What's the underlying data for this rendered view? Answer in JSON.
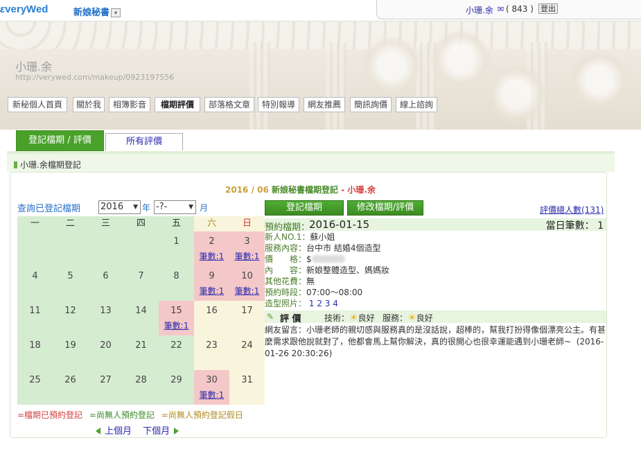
{
  "header": {
    "logo": "veryWed",
    "site_menu": "新娘秘書",
    "dropdown_icon": "▾",
    "user_name": "小珊.余",
    "mail_icon": "✉",
    "user_count": "( 843 )",
    "logout": "登出"
  },
  "profile": {
    "name": "小珊.余",
    "url": "http://verywed.com/makeup/0923197556"
  },
  "nav": [
    {
      "label": "新秘個人首頁"
    },
    {
      "label": "關於我"
    },
    {
      "label": "相簿影音"
    },
    {
      "label": "檔期評價",
      "active": true
    },
    {
      "label": "部落格文章"
    },
    {
      "label": "特別報導"
    },
    {
      "label": "網友推薦"
    },
    {
      "label": "簡訊詢價"
    },
    {
      "label": "線上諮詢"
    }
  ],
  "tabs": {
    "register": "登記檔期 / 評價",
    "all_reviews": "所有評價"
  },
  "sub_title": "小珊.余檔期登記",
  "reg_heading": {
    "date": "2016 / 06",
    "title": "新娘秘書檔期登記",
    "sep": "-",
    "name": "小珊.余"
  },
  "query": {
    "label": "查詢已登記檔期",
    "year": "2016",
    "year_unit": "年",
    "month": "-?-",
    "month_unit": "月"
  },
  "calendar": {
    "weekdays": [
      "一",
      "二",
      "三",
      "四",
      "五",
      "六",
      "日"
    ],
    "booking_label": "筆數:1",
    "days": [
      {
        "d": "1",
        "col": 4,
        "row": 0
      },
      {
        "d": "2",
        "col": 5,
        "row": 0,
        "booked": true
      },
      {
        "d": "3",
        "col": 6,
        "row": 0,
        "booked": true
      },
      {
        "d": "4",
        "col": 0,
        "row": 1
      },
      {
        "d": "5",
        "col": 1,
        "row": 1
      },
      {
        "d": "6",
        "col": 2,
        "row": 1
      },
      {
        "d": "7",
        "col": 3,
        "row": 1
      },
      {
        "d": "8",
        "col": 4,
        "row": 1
      },
      {
        "d": "9",
        "col": 5,
        "row": 1,
        "booked": true
      },
      {
        "d": "10",
        "col": 6,
        "row": 1,
        "booked": true
      },
      {
        "d": "11",
        "col": 0,
        "row": 2
      },
      {
        "d": "12",
        "col": 1,
        "row": 2
      },
      {
        "d": "13",
        "col": 2,
        "row": 2
      },
      {
        "d": "14",
        "col": 3,
        "row": 2
      },
      {
        "d": "15",
        "col": 4,
        "row": 2,
        "booked": true
      },
      {
        "d": "16",
        "col": 5,
        "row": 2
      },
      {
        "d": "17",
        "col": 6,
        "row": 2
      },
      {
        "d": "18",
        "col": 0,
        "row": 3
      },
      {
        "d": "19",
        "col": 1,
        "row": 3
      },
      {
        "d": "20",
        "col": 2,
        "row": 3
      },
      {
        "d": "21",
        "col": 3,
        "row": 3
      },
      {
        "d": "22",
        "col": 4,
        "row": 3
      },
      {
        "d": "23",
        "col": 5,
        "row": 3
      },
      {
        "d": "24",
        "col": 6,
        "row": 3
      },
      {
        "d": "25",
        "col": 0,
        "row": 4
      },
      {
        "d": "26",
        "col": 1,
        "row": 4
      },
      {
        "d": "27",
        "col": 2,
        "row": 4
      },
      {
        "d": "28",
        "col": 3,
        "row": 4
      },
      {
        "d": "29",
        "col": 4,
        "row": 4
      },
      {
        "d": "30",
        "col": 5,
        "row": 4,
        "booked": true
      },
      {
        "d": "31",
        "col": 6,
        "row": 4
      }
    ]
  },
  "legend": {
    "booked": "=檔期已預約登記",
    "free": "=尚無人預約登記",
    "free_holiday": "=尚無人預約登記假日"
  },
  "month_nav": {
    "prev": "上個月",
    "next": "下個月"
  },
  "buttons": {
    "register": "登記檔期",
    "modify": "修改檔期/評價"
  },
  "review_count": "評價總人數(131)",
  "detail": {
    "date_label": "預約檔期：",
    "date": "2016-01-15",
    "day_count": "當日筆數： 1",
    "rows": [
      {
        "label": "新人NO.1：",
        "value": "蘇小姐"
      },
      {
        "label": "服務內容：",
        "value": "台中市 結婚4個造型"
      },
      {
        "label": "價　　格：",
        "value": "$"
      },
      {
        "label": "內　　容：",
        "value": "新娘整體造型、媽媽妝"
      },
      {
        "label": "其他花費：",
        "value": "無"
      },
      {
        "label": "預約時段：",
        "value": "07:00～08:00"
      },
      {
        "label": "造型照片：",
        "value": "1 2 3 4"
      }
    ],
    "photos": [
      "1",
      "2",
      "3",
      "4"
    ],
    "review_title": "評 價",
    "tech_label": "技術：",
    "tech_value": "良好",
    "service_label": "服務：",
    "service_value": "良好",
    "comment": "網友留言：小珊老師的親切感與服務真的是沒話說，超棒的，幫我打扮得像個漂亮公主。有甚麼需求跟他說就對了，他都會馬上幫你解決，真的很開心也很幸運能遇到小珊老師~",
    "comment_time": "(2016-01-26 20:30:26)"
  },
  "colors": {
    "green": "#4aa12a",
    "booked": "#f4c8c8",
    "weekday": "#d6ecd1",
    "weekend": "#f8f5dc"
  }
}
